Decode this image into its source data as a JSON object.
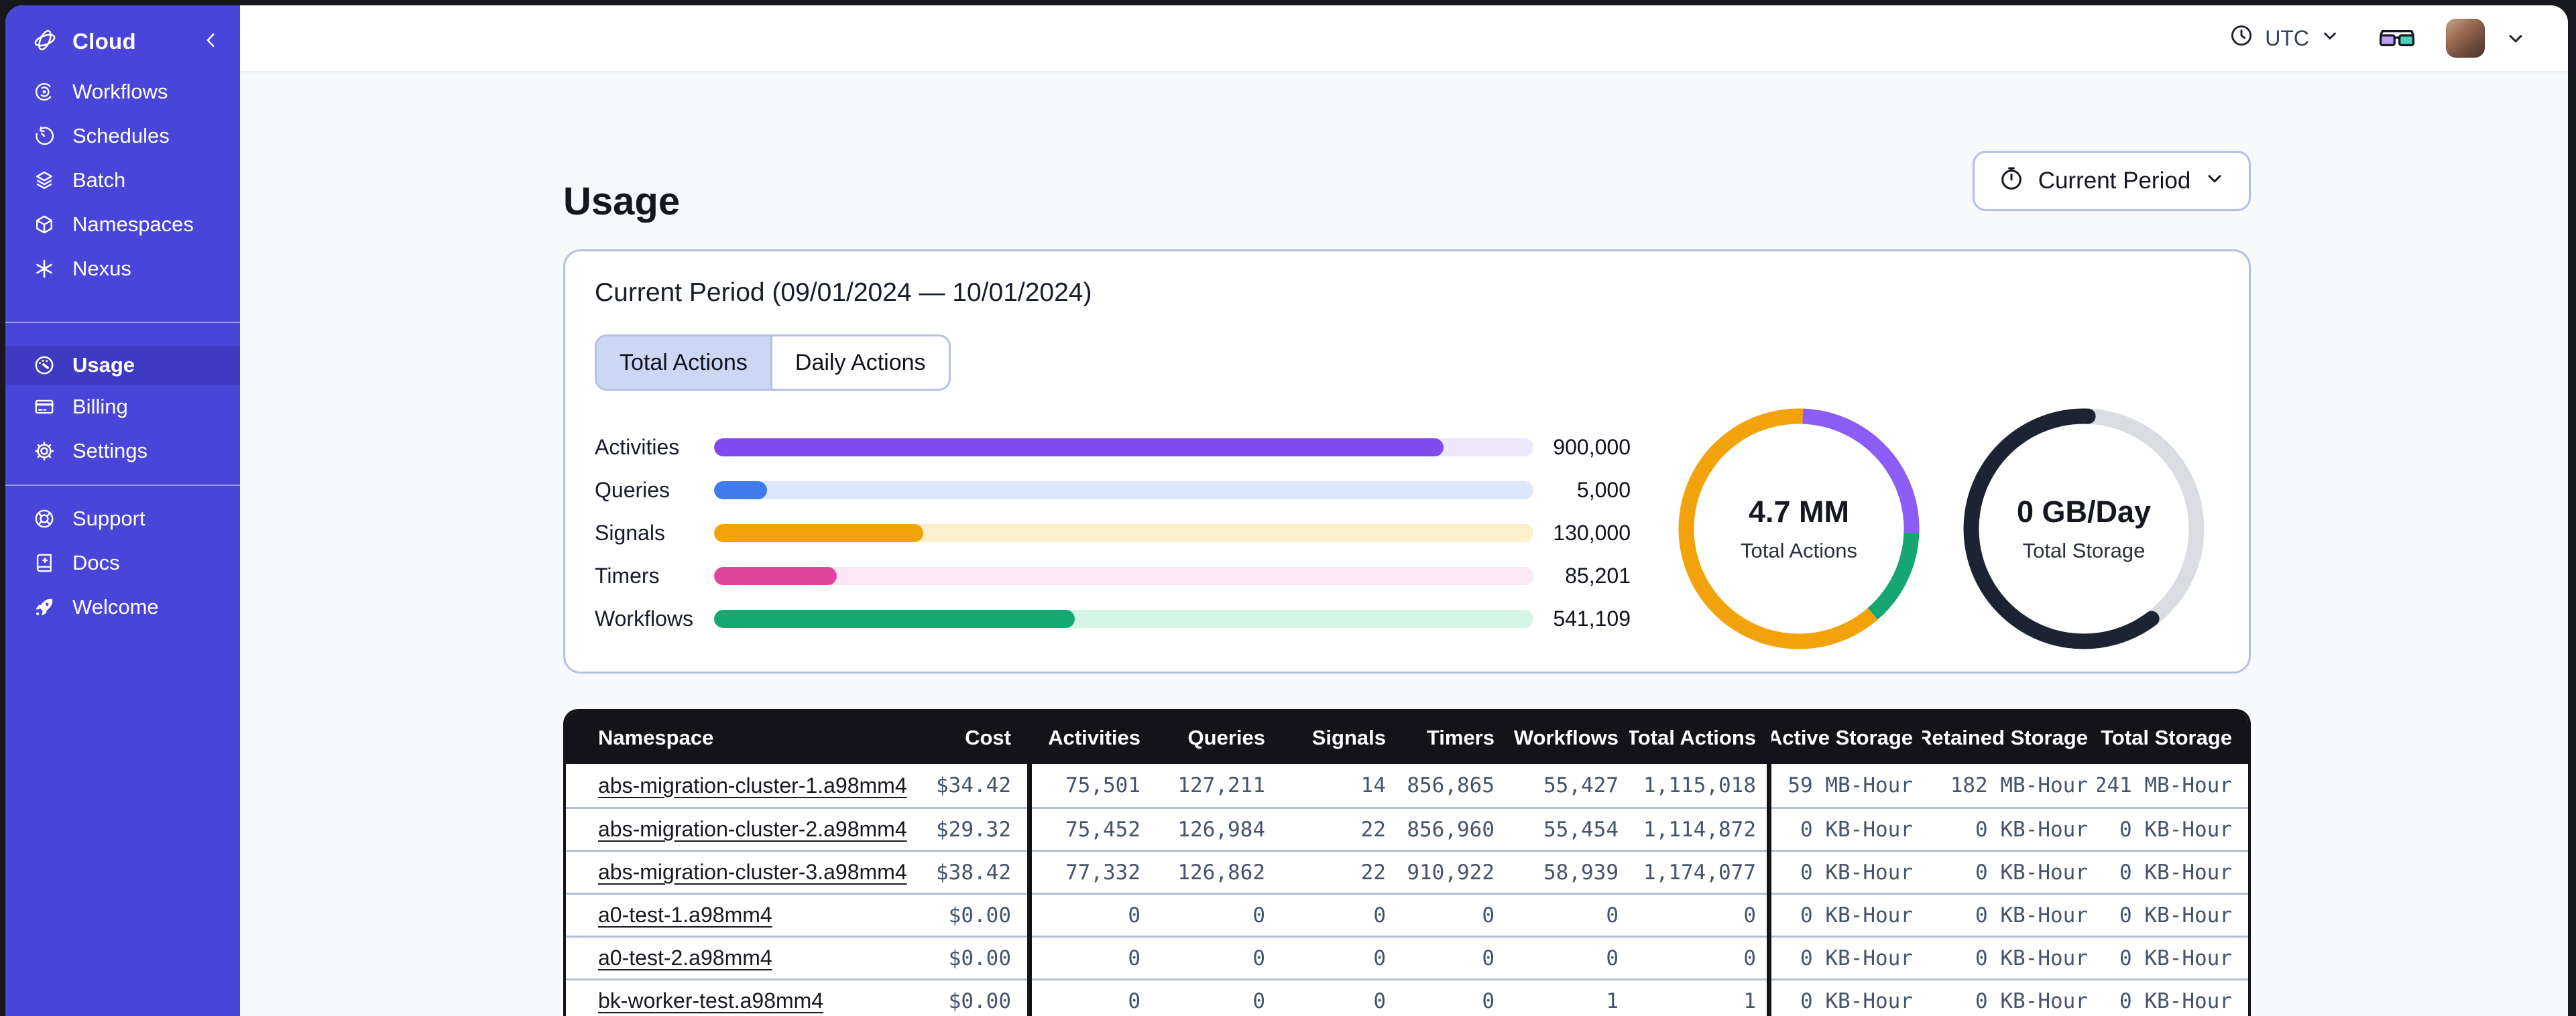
{
  "sidebar": {
    "logo": {
      "label": "Cloud"
    },
    "nav_primary": [
      {
        "label": "Workflows",
        "icon": "workflows-icon"
      },
      {
        "label": "Schedules",
        "icon": "schedules-icon"
      },
      {
        "label": "Batch",
        "icon": "batch-icon"
      },
      {
        "label": "Namespaces",
        "icon": "namespaces-icon"
      },
      {
        "label": "Nexus",
        "icon": "nexus-icon"
      }
    ],
    "nav_account": [
      {
        "label": "Usage",
        "icon": "gauge-icon",
        "active": true
      },
      {
        "label": "Billing",
        "icon": "credit-card-icon"
      },
      {
        "label": "Settings",
        "icon": "gear-icon"
      }
    ],
    "nav_footer": [
      {
        "label": "Support",
        "icon": "lifebuoy-icon"
      },
      {
        "label": "Docs",
        "icon": "book-icon"
      },
      {
        "label": "Welcome",
        "icon": "rocket-icon"
      }
    ],
    "colors": {
      "bg": "#4a45d9",
      "active_bg": "#3e3ac2"
    }
  },
  "topbar": {
    "timezone": "UTC"
  },
  "page": {
    "title": "Usage",
    "period_button_label": "Current Period"
  },
  "usage_card": {
    "title": "Current Period (09/01/2024 — 10/01/2024)",
    "tabs": [
      {
        "label": "Total Actions",
        "active": true
      },
      {
        "label": "Daily Actions",
        "active": false
      }
    ]
  },
  "chart_data": {
    "type": "bar",
    "categories": [
      "Activities",
      "Queries",
      "Signals",
      "Timers",
      "Workflows"
    ],
    "values": [
      900000,
      5000,
      130000,
      85201,
      541109
    ],
    "value_labels": [
      "900,000",
      "5,000",
      "130,000",
      "85,201",
      "541,109"
    ],
    "fill_percent": [
      89,
      6.5,
      25.5,
      15,
      44
    ],
    "bar_colors": [
      "#7e4bee",
      "#3f7bef",
      "#f2a30b",
      "#e0459c",
      "#13a970"
    ],
    "track_colors": [
      "#ede7fb",
      "#dce7fb",
      "#fbf0cb",
      "#fbe6f4",
      "#d5f6e6"
    ],
    "donuts": [
      {
        "value": "4.7 MM",
        "label": "Total Actions",
        "segments": [
          {
            "color": "#f2a30b",
            "start": 139,
            "sweep": 223,
            "cap": "butt"
          },
          {
            "color": "#8b5cf6",
            "start": 2,
            "sweep": 90,
            "cap": "butt"
          },
          {
            "color": "#16a674",
            "start": 92,
            "sweep": 47,
            "cap": "butt"
          }
        ]
      },
      {
        "value": "0 GB/Day",
        "label": "Total Storage",
        "segments": [
          {
            "color": "#d9dce1",
            "start": 2,
            "sweep": 141,
            "cap": "butt"
          },
          {
            "color": "#1c2433",
            "start": 143,
            "sweep": 219,
            "cap": "round"
          }
        ]
      }
    ]
  },
  "table": {
    "headers": [
      "Namespace",
      "Cost",
      "Activities",
      "Queries",
      "Signals",
      "Timers",
      "Workflows",
      "Total Actions",
      "Active Storage",
      "Retained Storage",
      "Total Storage"
    ],
    "rows": [
      {
        "namespace": "abs-migration-cluster-1.a98mm4",
        "cost": "$34.42",
        "activities": "75,501",
        "queries": "127,211",
        "signals": "14",
        "timers": "856,865",
        "workflows": "55,427",
        "total_actions": "1,115,018",
        "active_storage": "59 MB-Hour",
        "retained_storage": "182 MB-Hour",
        "total_storage": "241 MB-Hour"
      },
      {
        "namespace": "abs-migration-cluster-2.a98mm4",
        "cost": "$29.32",
        "activities": "75,452",
        "queries": "126,984",
        "signals": "22",
        "timers": "856,960",
        "workflows": "55,454",
        "total_actions": "1,114,872",
        "active_storage": "0 KB-Hour",
        "retained_storage": "0 KB-Hour",
        "total_storage": "0 KB-Hour"
      },
      {
        "namespace": "abs-migration-cluster-3.a98mm4",
        "cost": "$38.42",
        "activities": "77,332",
        "queries": "126,862",
        "signals": "22",
        "timers": "910,922",
        "workflows": "58,939",
        "total_actions": "1,174,077",
        "active_storage": "0 KB-Hour",
        "retained_storage": "0 KB-Hour",
        "total_storage": "0 KB-Hour"
      },
      {
        "namespace": "a0-test-1.a98mm4",
        "cost": "$0.00",
        "activities": "0",
        "queries": "0",
        "signals": "0",
        "timers": "0",
        "workflows": "0",
        "total_actions": "0",
        "active_storage": "0 KB-Hour",
        "retained_storage": "0 KB-Hour",
        "total_storage": "0 KB-Hour"
      },
      {
        "namespace": "a0-test-2.a98mm4",
        "cost": "$0.00",
        "activities": "0",
        "queries": "0",
        "signals": "0",
        "timers": "0",
        "workflows": "0",
        "total_actions": "0",
        "active_storage": "0 KB-Hour",
        "retained_storage": "0 KB-Hour",
        "total_storage": "0 KB-Hour"
      },
      {
        "namespace": "bk-worker-test.a98mm4",
        "cost": "$0.00",
        "activities": "0",
        "queries": "0",
        "signals": "0",
        "timers": "0",
        "workflows": "1",
        "total_actions": "1",
        "active_storage": "0 KB-Hour",
        "retained_storage": "0 KB-Hour",
        "total_storage": "0 KB-Hour"
      }
    ]
  }
}
